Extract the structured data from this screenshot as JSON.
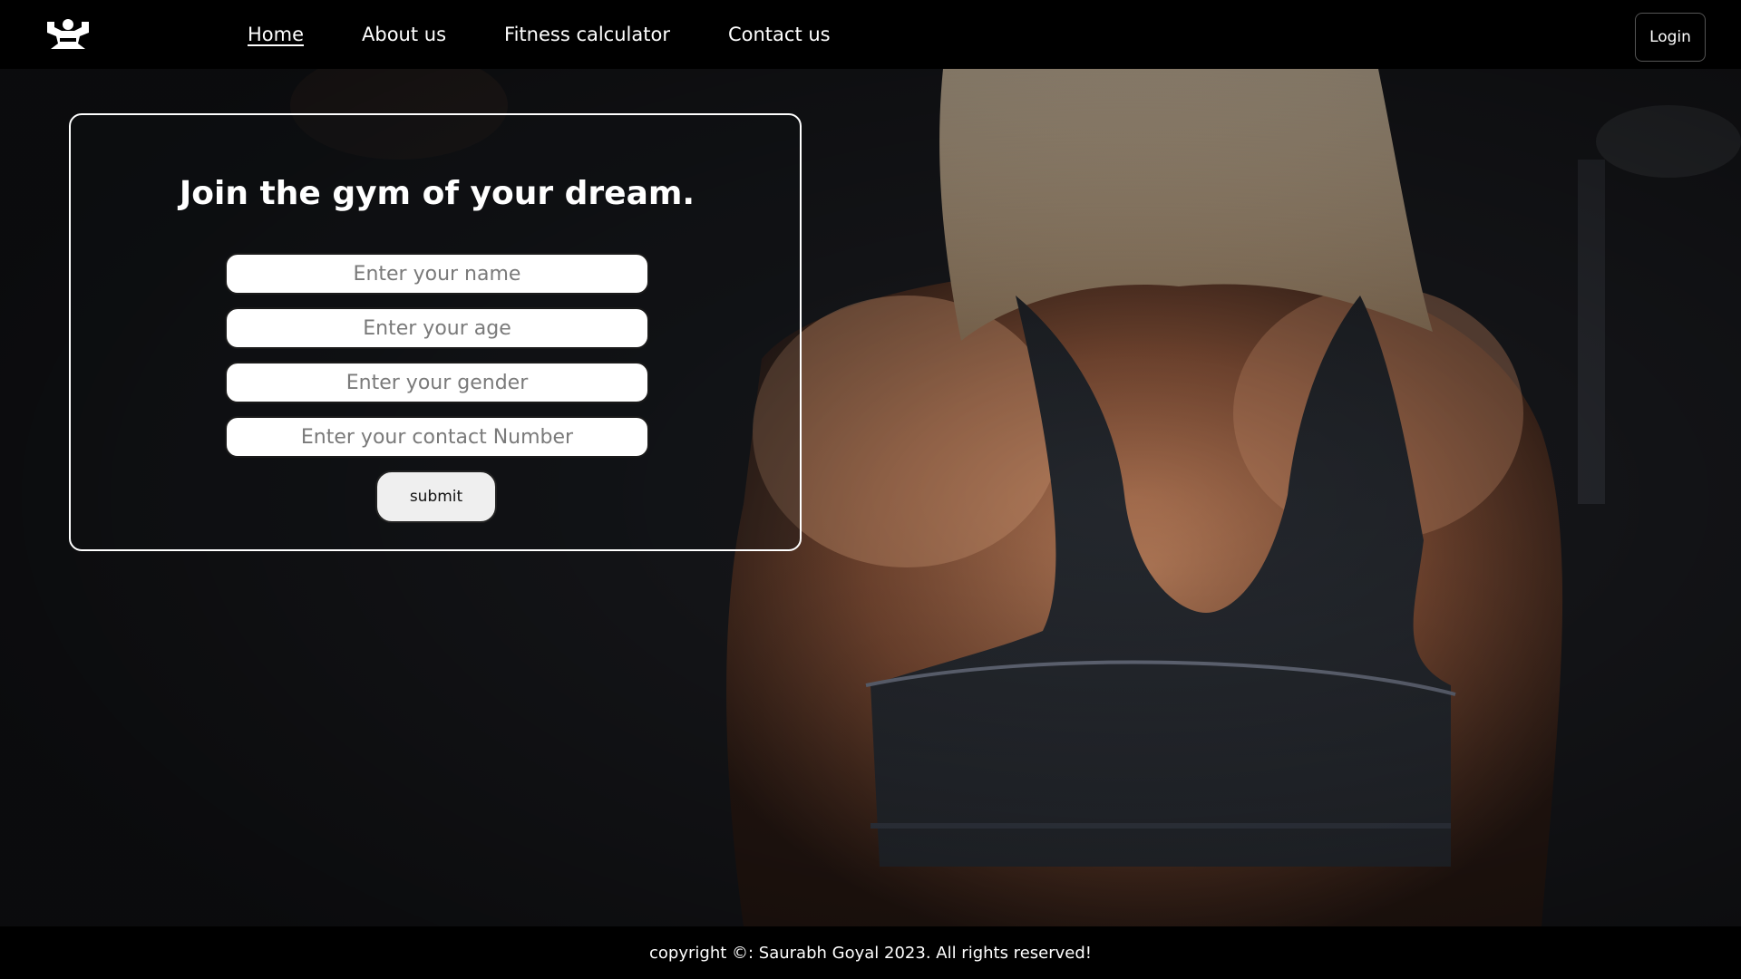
{
  "nav": {
    "logo_icon": "bodybuilder-logo-icon",
    "links": [
      {
        "label": "Home",
        "active": true
      },
      {
        "label": "About us",
        "active": false
      },
      {
        "label": "Fitness calculator",
        "active": false
      },
      {
        "label": "Contact us",
        "active": false
      }
    ],
    "login_label": "Login"
  },
  "form": {
    "title": "Join the gym of your dream.",
    "name_placeholder": "Enter your name",
    "age_placeholder": "Enter your age",
    "gender_placeholder": "Enter your gender",
    "contact_placeholder": "Enter your contact Number",
    "submit_label": "submit"
  },
  "footer": {
    "text": "copyright ©: Saurabh Goyal 2023. All rights reserved!"
  },
  "colors": {
    "background": "#000000",
    "text": "#ffffff",
    "input_bg": "#ffffff",
    "button_bg": "#efefef"
  }
}
